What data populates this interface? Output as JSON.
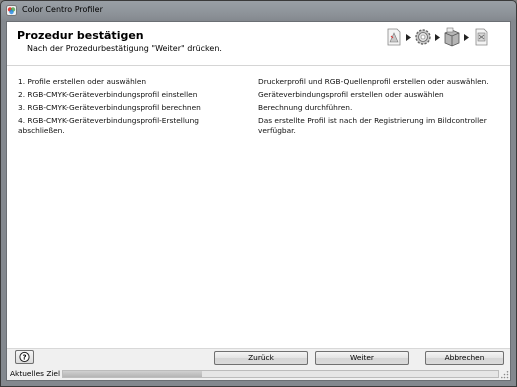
{
  "window": {
    "title": "Color Centro Profiler"
  },
  "header": {
    "title": "Prozedur bestätigen",
    "subtitle": "Nach der Prozedurbestätigung \"Weiter\" drücken.",
    "step_icons": [
      "profile-document-icon",
      "gear-icon",
      "printer-box-icon",
      "document-link-icon"
    ]
  },
  "procedure": [
    {
      "step": "1. Profile erstellen oder auswählen",
      "description": "Druckerprofil und RGB-Quellenprofil erstellen oder auswählen."
    },
    {
      "step": "2. RGB-CMYK-Geräteverbindungsprofil einstellen",
      "description": "Geräteverbindungsprofil erstellen oder auswählen"
    },
    {
      "step": "3. RGB-CMYK-Geräteverbindungsprofil berechnen",
      "description": "Berechnung durchführen."
    },
    {
      "step": "4. RGB-CMYK-Geräteverbindungsprofil-Erstellung abschließen.",
      "description": "Das erstellte Profil ist nach der Registrierung im Bildcontroller verfügbar."
    }
  ],
  "footer": {
    "help_label": "?",
    "back_label": "Zurück",
    "next_label": "Weiter",
    "cancel_label": "Abbrechen"
  },
  "status": {
    "label": "Aktuelles Ziel",
    "progress_fraction": 0.32
  },
  "colors": {
    "title_bar": "#8c9197",
    "header_bg": "#ffffff",
    "content_bg": "#ffffff",
    "frame_bg": "#f0f0f0"
  }
}
